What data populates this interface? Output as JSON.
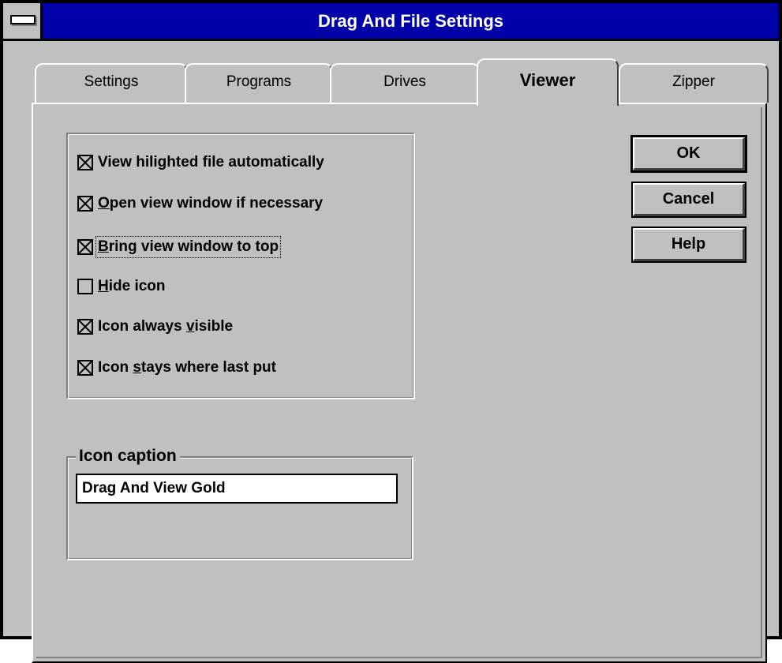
{
  "window": {
    "title": "Drag And File Settings"
  },
  "tabs": [
    {
      "label": "Settings",
      "active": false
    },
    {
      "label": "Programs",
      "active": false
    },
    {
      "label": "Drives",
      "active": false
    },
    {
      "label": "Viewer",
      "active": true
    },
    {
      "label": "Zipper",
      "active": false
    }
  ],
  "options": [
    {
      "pre": "",
      "accel": "",
      "post": "View hilighted file automatically",
      "checked": true
    },
    {
      "pre": "",
      "accel": "O",
      "post": "pen view window if necessary",
      "checked": true
    },
    {
      "pre": "",
      "accel": "B",
      "post": "ring view window to top",
      "checked": true
    },
    {
      "pre": "",
      "accel": "H",
      "post": "ide icon",
      "checked": false
    },
    {
      "pre": "Icon always ",
      "accel": "v",
      "post": "isible",
      "checked": true
    },
    {
      "pre": "Icon ",
      "accel": "s",
      "post": "tays where last put",
      "checked": true
    }
  ],
  "buttons": {
    "ok": "OK",
    "cancel": "Cancel",
    "help": "Help"
  },
  "icon_caption": {
    "label": "Icon caption",
    "value": "Drag And View Gold"
  },
  "icons": {
    "system_menu": "system-menu-icon",
    "checkbox": "checkbox-icon"
  }
}
